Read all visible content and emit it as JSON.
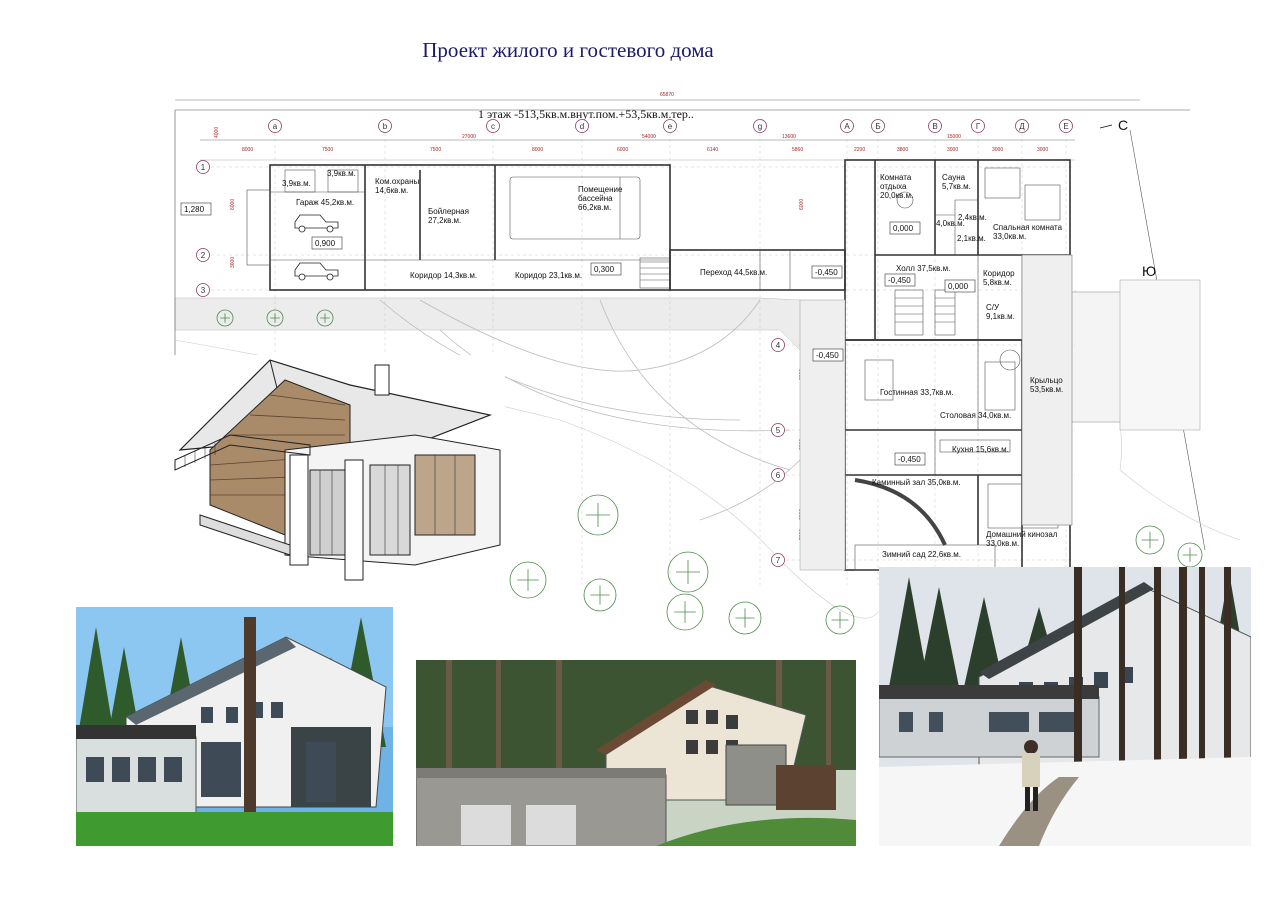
{
  "title": "Проект жилого и гостевого дома",
  "plan": {
    "floor_caption": "1 этаж -513,5кв.м.внут.пом.+53,5кв.м.тер..",
    "compass": {
      "north": "С",
      "south": "Ю"
    },
    "axes_letters": [
      "a",
      "b",
      "c",
      "d",
      "e",
      "g",
      "A",
      "Б",
      "В",
      "Г",
      "Д",
      "Е"
    ],
    "axes_numbers": [
      "1",
      "2",
      "3",
      "4",
      "5",
      "6",
      "7"
    ],
    "overall_dim": "65870",
    "segment_dims": [
      "8000",
      "7500",
      "7500",
      "8000",
      "6000",
      "6140",
      "5860",
      "2200",
      "3800",
      "3000",
      "3000",
      "3000"
    ],
    "group_dims": [
      "27000",
      "54000",
      "13600",
      "15000"
    ],
    "side_dims": [
      "4000",
      "6000",
      "3600",
      "6000",
      "2000",
      "3000",
      "3000",
      "5000"
    ],
    "level_marks": [
      "1,280",
      "0,900",
      "0,300",
      "-0,450",
      "-0,450",
      "-0,450",
      "0,000",
      "0,000",
      "-0,450"
    ],
    "rooms": [
      {
        "name": "3,9кв.м.",
        "area": ""
      },
      {
        "name": "3,9кв.м.",
        "area": ""
      },
      {
        "name": "Гараж",
        "area": "45,2кв.м."
      },
      {
        "name": "Ком.охраны",
        "area": "14,6кв.м."
      },
      {
        "name": "Бойлерная",
        "area": "27,2кв.м."
      },
      {
        "name": "Помещение бассейна",
        "area": "66,2кв.м."
      },
      {
        "name": "Коридор",
        "area": "14,3кв.м."
      },
      {
        "name": "Коридор",
        "area": "23,1кв.м."
      },
      {
        "name": "Переход",
        "area": "44,5кв.м."
      },
      {
        "name": "Комната отдыха",
        "area": "20,0кв.м."
      },
      {
        "name": "Сауна",
        "area": "5,7кв.м."
      },
      {
        "name": "4,0кв.м.",
        "area": ""
      },
      {
        "name": "2,4кв.м.",
        "area": ""
      },
      {
        "name": "2,1кв.м.",
        "area": ""
      },
      {
        "name": "Спальная комната",
        "area": "33,0кв.м."
      },
      {
        "name": "Холл",
        "area": "37,5кв.м."
      },
      {
        "name": "Коридор",
        "area": "5,8кв.м."
      },
      {
        "name": "С/У",
        "area": "9,1кв.м."
      },
      {
        "name": "Гостинная",
        "area": "33,7кв.м."
      },
      {
        "name": "Столовая",
        "area": "34,0кв.м."
      },
      {
        "name": "Крыльцо",
        "area": "53,5кв.м."
      },
      {
        "name": "Кухня",
        "area": "15,6кв.м."
      },
      {
        "name": "Каминный зал",
        "area": "35,0кв.м."
      },
      {
        "name": "Домашний кинозал",
        "area": "33,0кв.м."
      },
      {
        "name": "Зимний сад",
        "area": "22,6кв.м."
      }
    ]
  },
  "images": [
    {
      "name": "axonometric-sketch"
    },
    {
      "name": "photo-house-summer"
    },
    {
      "name": "render-garage-view"
    },
    {
      "name": "photo-house-winter"
    }
  ],
  "colors": {
    "title": "#1a1a66",
    "axis_circle": "#8b3a6a",
    "dimension": "#a22222"
  }
}
